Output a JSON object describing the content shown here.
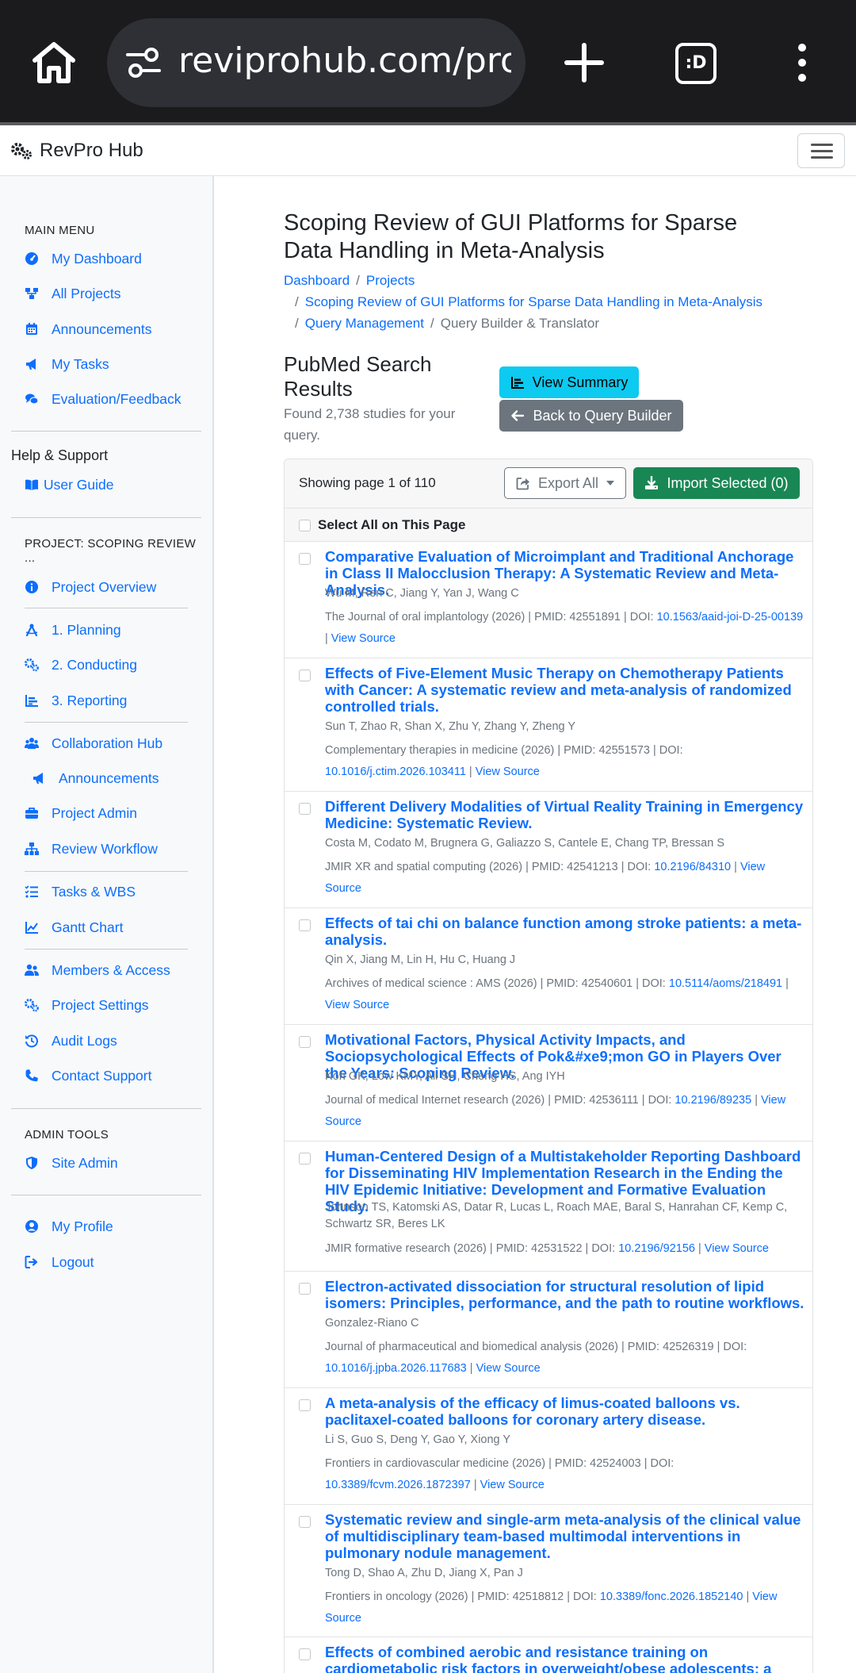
{
  "browser": {
    "url": "reviprohub.com/projects/",
    "tabs_icon_text": ":D"
  },
  "navbar": {
    "brand": "RevPro Hub"
  },
  "sidebar": {
    "main_menu_heading": "MAIN MENU",
    "main_items": [
      "My Dashboard",
      "All Projects",
      "Announcements",
      "My Tasks",
      "Evaluation/Feedback"
    ],
    "help_heading": "Help & Support",
    "help_items": [
      "User Guide"
    ],
    "project_heading": "PROJECT: SCOPING REVIEW ...",
    "project_items": [
      "Project Overview",
      "1. Planning",
      "2. Conducting",
      "3. Reporting",
      "Collaboration Hub",
      "Announcements",
      "Project Admin",
      "Review Workflow",
      "Tasks & WBS",
      "Gantt Chart",
      "Members & Access",
      "Project Settings",
      "Audit Logs",
      "Contact Support"
    ],
    "admin_heading": "ADMIN TOOLS",
    "admin_items": [
      "Site Admin"
    ],
    "user_items": [
      "My Profile",
      "Logout"
    ]
  },
  "main": {
    "title": "Scoping Review of GUI Platforms for Sparse Data Handling in Meta-Analysis",
    "breadcrumb": [
      "Dashboard",
      "Projects",
      "Scoping Review of GUI Platforms for Sparse Data Handling in Meta-Analysis",
      "Query Management",
      "Query Builder & Translator"
    ],
    "breadcrumb_sep": "/",
    "results_title": "PubMed Search Results",
    "found_text": "Found 2,738 studies for your query.",
    "view_summary": "View Summary",
    "back_button": "Back to Query Builder",
    "showing": "Showing page 1 of 110",
    "export_all": "Export All",
    "import_selected": "Import Selected (0)",
    "select_all": "Select All on This Page",
    "source_link": "View Source",
    "results": [
      {
        "title": "Comparative Evaluation of Microimplant and Traditional Anchorage in Class II Malocclusion Therapy: A Systematic Review and Meta-Analysis.",
        "authors": "Wu M, Ren C, Jiang Y, Yan J, Wang C",
        "journal": "The Journal of oral implantology (2026) | PMID: 42551891 | DOI:",
        "doi": "10.1563/aaid-joi-D-25-00139"
      },
      {
        "title": "Effects of Five-Element Music Therapy on Chemotherapy Patients with Cancer: A systematic review and meta-analysis of randomized controlled trials.",
        "authors": "Sun T, Zhao R, Shan X, Zhu Y, Zhang Y, Zheng Y",
        "journal": "Complementary therapies in medicine (2026) | PMID: 42551573 | DOI:",
        "doi": "10.1016/j.ctim.2026.103411"
      },
      {
        "title": "Different Delivery Modalities of Virtual Reality Training in Emergency Medicine: Systematic Review.",
        "authors": "Costa M, Codato M, Brugnera G, Galiazzo S, Cantele E, Chang TP, Bressan S",
        "journal": "JMIR XR and spatial computing (2026) | PMID: 42541213 | DOI:",
        "doi": "10.2196/84310"
      },
      {
        "title": "Effects of tai chi on balance function among stroke patients: a meta-analysis.",
        "authors": "Qin X, Jiang M, Lin H, Hu C, Huang J",
        "journal": "Archives of medical science : AMS (2026) | PMID: 42540601 | DOI:",
        "doi": "10.5114/aoms/218491"
      },
      {
        "title": "Motivational Factors, Physical Activity Impacts, and Sociopsychological Effects of Pok&#xe9;mon GO in Players Over the Years: Scoping Review.",
        "authors": "Koh GK, Low KMY, Ali SH, Cheng HS, Ang IYH",
        "journal": "Journal of medical Internet research (2026) | PMID: 42536111 | DOI:",
        "doi": "10.2196/89235"
      },
      {
        "title": "Human-Centered Design of a Multistakeholder Reporting Dashboard for Disseminating HIV Implementation Research in the Ending the HIV Epidemic Initiative: Development and Formative Evaluation Study.",
        "authors": "Johnson TS, Katomski AS, Datar R, Lucas L, Roach MAE, Baral S, Hanrahan CF, Kemp C, Schwartz SR, Beres LK",
        "journal": "JMIR formative research (2026) | PMID: 42531522 | DOI:",
        "doi": "10.2196/92156"
      },
      {
        "title": "Electron-activated dissociation for structural resolution of lipid isomers: Principles, performance, and the path to routine workflows.",
        "authors": "Gonzalez-Riano C",
        "journal": "Journal of pharmaceutical and biomedical analysis (2026) | PMID: 42526319 | DOI:",
        "doi": "10.1016/j.jpba.2026.117683"
      },
      {
        "title": "A meta-analysis of the efficacy of limus-coated balloons vs. paclitaxel-coated balloons for coronary artery disease.",
        "authors": "Li S, Guo S, Deng Y, Gao Y, Xiong Y",
        "journal": "Frontiers in cardiovascular medicine (2026) | PMID: 42524003 | DOI:",
        "doi": "10.3389/fcvm.2026.1872397"
      },
      {
        "title": "Systematic review and single-arm meta-analysis of the clinical value of multidisciplinary team-based multimodal interventions in pulmonary nodule management.",
        "authors": "Tong D, Shao A, Zhu D, Jiang X, Pan J",
        "journal": "Frontiers in oncology (2026) | PMID: 42518812 | DOI:",
        "doi": "10.3389/fonc.2026.1852140"
      },
      {
        "title": "Effects of combined aerobic and resistance training on cardiometabolic risk factors in overweight/obese adolescents: a systematic review and meta-analysis.",
        "authors": "",
        "journal": "",
        "doi": ""
      }
    ]
  }
}
